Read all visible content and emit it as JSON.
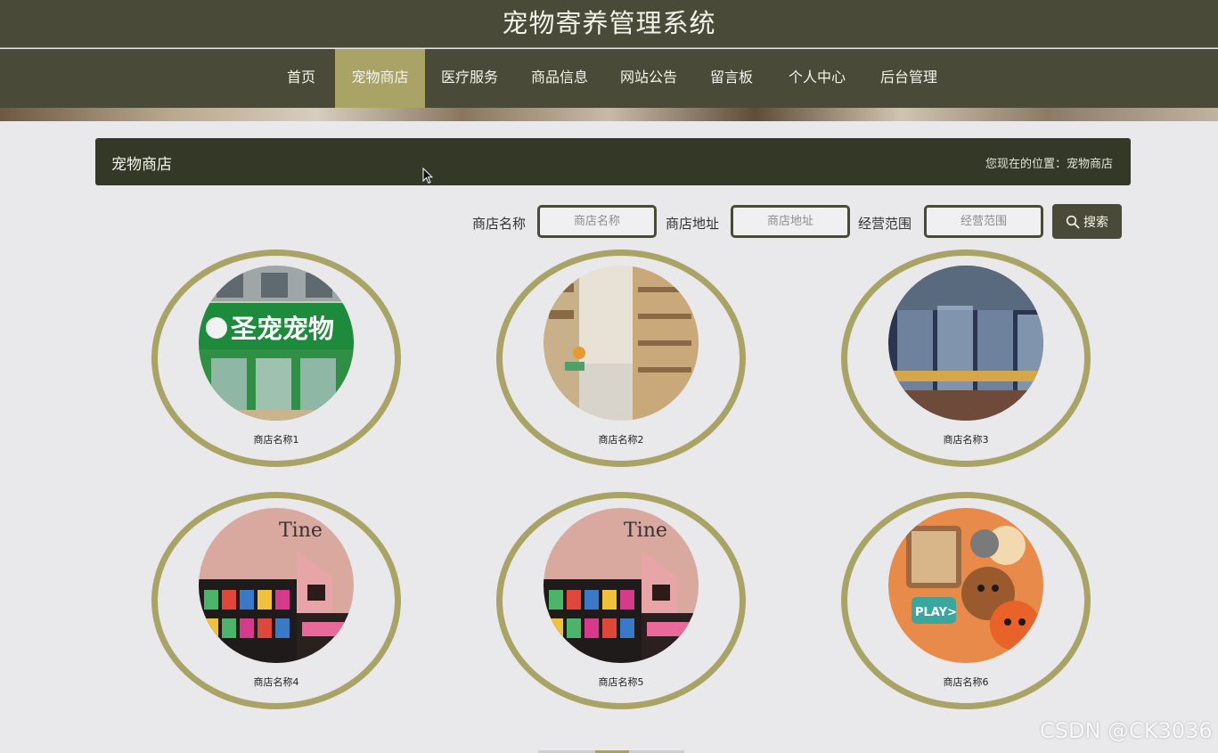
{
  "header": {
    "site_title": "宠物寄养管理系统"
  },
  "nav": {
    "items": [
      {
        "label": "首页"
      },
      {
        "label": "宠物商店"
      },
      {
        "label": "医疗服务"
      },
      {
        "label": "商品信息"
      },
      {
        "label": "网站公告"
      },
      {
        "label": "留言板"
      },
      {
        "label": "个人中心"
      },
      {
        "label": "后台管理"
      }
    ],
    "active_label": "宠物商店"
  },
  "panel": {
    "title": "宠物商店",
    "breadcrumb": "您现在的位置：宠物商店"
  },
  "search": {
    "fields": [
      {
        "label": "商店名称",
        "placeholder": "商店名称"
      },
      {
        "label": "商店地址",
        "placeholder": "商店地址"
      },
      {
        "label": "经营范围",
        "placeholder": "经营范围"
      }
    ],
    "button_label": "搜索",
    "button_icon": "search-icon"
  },
  "stores": [
    {
      "name": "商店名称1",
      "photo_text": "圣宠宠物"
    },
    {
      "name": "商店名称2"
    },
    {
      "name": "商店名称3"
    },
    {
      "name": "商店名称4",
      "photo_text": "Tine"
    },
    {
      "name": "商店名称5",
      "photo_text": "Tine"
    },
    {
      "name": "商店名称6",
      "photo_text": "PLAY>"
    }
  ],
  "watermark": "CSDN @CK3036",
  "colors": {
    "dark_olive": "#4a4a38",
    "accent_olive": "#a9a466",
    "panel_dark": "#343826",
    "page_bg": "#e9e8ea"
  }
}
